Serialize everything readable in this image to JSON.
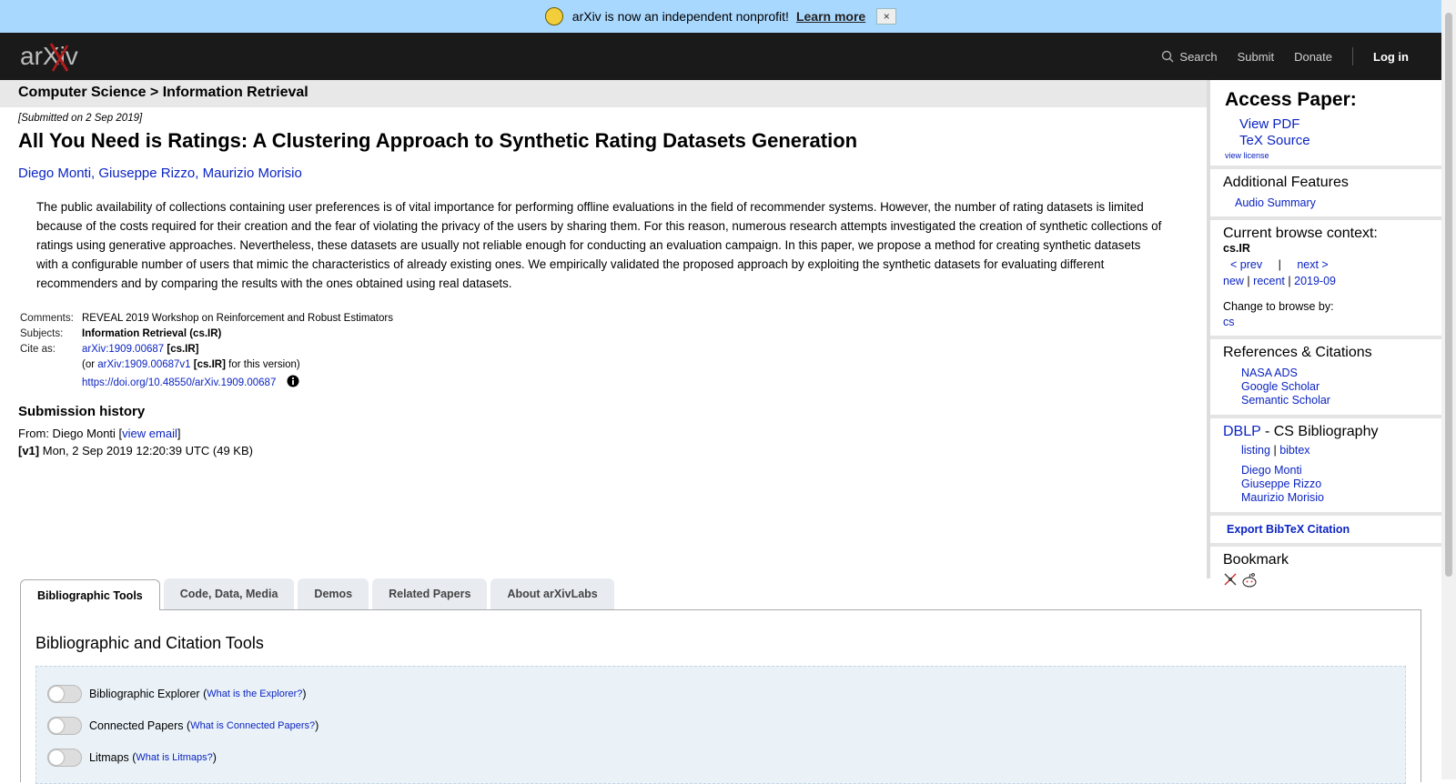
{
  "banner": {
    "message": "arXiv is now an independent nonprofit!",
    "learn_more": "Learn more",
    "close": "×"
  },
  "header": {
    "logo_text": "arXiv",
    "search": "Search",
    "submit": "Submit",
    "donate": "Donate",
    "login": "Log in"
  },
  "breadcrumb": "Computer Science > Information Retrieval",
  "paper": {
    "submitted": "[Submitted on 2 Sep 2019]",
    "title": "All You Need is Ratings: A Clustering Approach to Synthetic Rating Datasets Generation",
    "authors": [
      "Diego Monti",
      "Giuseppe Rizzo",
      "Maurizio Morisio"
    ],
    "abstract": "The public availability of collections containing user preferences is of vital importance for performing offline evaluations in the field of recommender systems. However, the number of rating datasets is limited because of the costs required for their creation and the fear of violating the privacy of the users by sharing them. For this reason, numerous research attempts investigated the creation of synthetic collections of ratings using generative approaches. Nevertheless, these datasets are usually not reliable enough for conducting an evaluation campaign. In this paper, we propose a method for creating synthetic datasets with a configurable number of users that mimic the characteristics of already existing ones. We empirically validated the proposed approach by exploiting the synthetic datasets for evaluating different recommenders and by comparing the results with the ones obtained using real datasets.",
    "comments_label": "Comments:",
    "comments": "REVEAL 2019 Workshop on Reinforcement and Robust Estimators",
    "subjects_label": "Subjects:",
    "subjects": "Information Retrieval (cs.IR)",
    "cite_label": "Cite as:",
    "cite_id": "arXiv:1909.00687",
    "cite_cat": "[cs.IR]",
    "cite_or": "(or",
    "cite_v1": "arXiv:1909.00687v1",
    "cite_v1_cat": "[cs.IR]",
    "cite_v1_tail": "for this version)",
    "doi": "https://doi.org/10.48550/arXiv.1909.00687"
  },
  "history": {
    "title": "Submission history",
    "from": "From: Diego Monti [",
    "view_email": "view email",
    "from_end": "]",
    "v1": "[v1]",
    "v1_text": " Mon, 2 Sep 2019 12:20:39 UTC (49 KB)"
  },
  "sidebar": {
    "access_title": "Access Paper:",
    "view_pdf": "View PDF",
    "tex_source": "TeX Source",
    "view_license": "view license",
    "additional": "Additional Features",
    "audio": "Audio Summary",
    "context_title": "Current browse context:",
    "context": "cs.IR",
    "prev": "< prev",
    "pipe": "|",
    "next": "next >",
    "new": "new",
    "recent": "recent",
    "date": "2019-09",
    "change": "Change to browse by:",
    "cs": "cs",
    "refs_title": "References & Citations",
    "nasa": "NASA ADS",
    "google": "Google Scholar",
    "semantic": "Semantic Scholar",
    "dblp": "DBLP",
    "dblp_rest": " - CS Bibliography",
    "listing": "listing",
    "bibtex": "bibtex",
    "authors": [
      "Diego Monti",
      "Giuseppe Rizzo",
      "Maurizio Morisio"
    ],
    "export": "Export BibTeX Citation",
    "bookmark": "Bookmark"
  },
  "tabs": {
    "items": [
      "Bibliographic Tools",
      "Code, Data, Media",
      "Demos",
      "Related Papers",
      "About arXivLabs"
    ],
    "panel_title": "Bibliographic and Citation Tools",
    "tools": [
      {
        "name": "Bibliographic Explorer",
        "help": "What is the Explorer?"
      },
      {
        "name": "Connected Papers",
        "help": "What is Connected Papers?"
      },
      {
        "name": "Litmaps",
        "help": "What is Litmaps?"
      }
    ]
  }
}
